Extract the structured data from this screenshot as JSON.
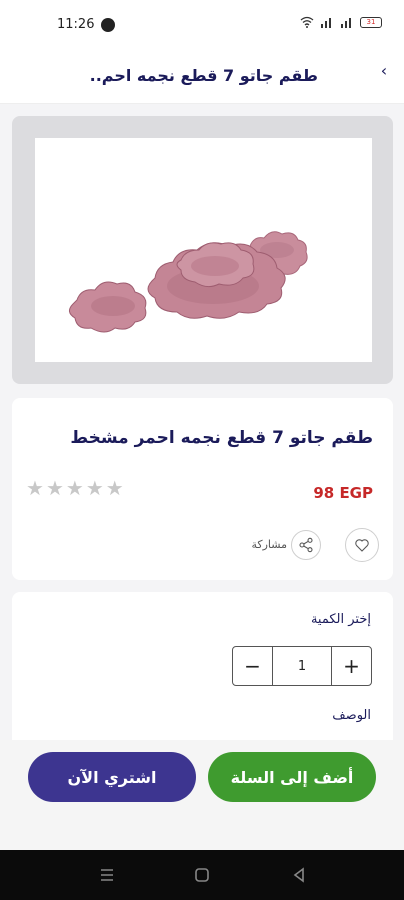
{
  "status": {
    "time": "11:26",
    "battery": "31"
  },
  "header": {
    "title": "طقم جاتو 7 قطع نجمه احم.."
  },
  "product": {
    "title": "طقم جاتو 7 قطع نجمه احمر مشخط",
    "price": "98 EGP",
    "rating": 0,
    "rating_max": 5
  },
  "actions": {
    "share_label": "مشاركة"
  },
  "quantity": {
    "label": "إختر الكمية",
    "value": "1"
  },
  "description": {
    "label": "الوصف"
  },
  "buttons": {
    "add_to_cart": "أضف إلى السلة",
    "buy_now": "اشتري الآن"
  },
  "colors": {
    "primary": "#3d3590",
    "cart": "#3f9b2f",
    "price": "#c62828",
    "title": "#1b1b5a"
  }
}
